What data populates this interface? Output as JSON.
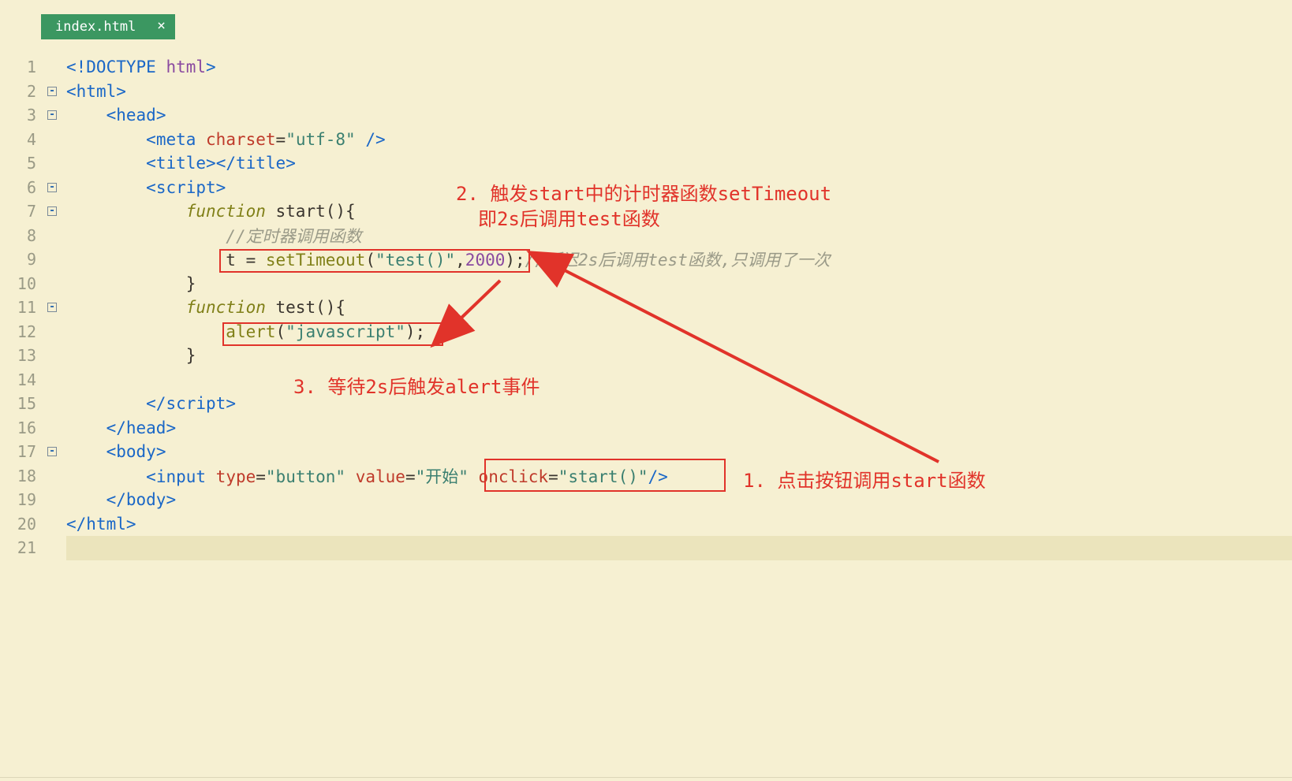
{
  "tab": {
    "filename": "index.html",
    "close_glyph": "×"
  },
  "fold_minus": "-",
  "code": {
    "l1_doctype": "<!DOCTYPE ",
    "l1_html": "html",
    "l1_close": ">",
    "l2_open": "<",
    "l2_tag": "html",
    "l2_close": ">",
    "l3_open": "<",
    "l3_tag": "head",
    "l3_close": ">",
    "l4_open": "<",
    "l4_tag": "meta ",
    "l4_attr": "charset",
    "l4_eq": "=",
    "l4_val": "\"utf-8\"",
    "l4_close": " />",
    "l5_open": "<",
    "l5_tag": "title",
    "l5_mid": ">",
    "l5_open2": "</",
    "l5_close": ">",
    "l6_open": "<",
    "l6_tag": "script",
    "l6_close": ">",
    "l7_kw": "function",
    "l7_name": " start",
    "l7_par": "(){",
    "l8_comment": "//定时器调用函数",
    "l9_pre": "t ",
    "l9_eq": "= ",
    "l9_fn": "setTimeout",
    "l9_par_open": "(",
    "l9_str": "\"test()\"",
    "l9_comma": ",",
    "l9_num": "2000",
    "l9_par_close": ");",
    "l9_comment": "//延迟2s后调用test函数,只调用了一次",
    "l10_brace": "}",
    "l11_kw": "function",
    "l11_name": " test",
    "l11_par": "(){",
    "l12_fn": "alert",
    "l12_par_open": "(",
    "l12_str": "\"javascript\"",
    "l12_par_close": ");",
    "l13_brace": "}",
    "l15_open": "</",
    "l15_tag": "script",
    "l15_close": ">",
    "l16_open": "</",
    "l16_tag": "head",
    "l16_close": ">",
    "l17_open": "<",
    "l17_tag": "body",
    "l17_close": ">",
    "l18_open": "<",
    "l18_tag": "input ",
    "l18_attr1": "type",
    "l18_eq": "=",
    "l18_val1": "\"button\"",
    "l18_sp1": " ",
    "l18_attr2": "value",
    "l18_val2": "\"开始\"",
    "l18_sp2": " ",
    "l18_attr3": "onclick",
    "l18_val3": "\"start()\"",
    "l18_close": "/>",
    "l19_open": "</",
    "l19_tag": "body",
    "l19_close": ">",
    "l20_open": "</",
    "l20_tag": "html",
    "l20_close": ">"
  },
  "annotations": {
    "a1": "1. 点击按钮调用start函数",
    "a2_line1": "2. 触发start中的计时器函数setTimeout",
    "a2_line2": "即2s后调用test函数",
    "a3": "3. 等待2s后触发alert事件"
  },
  "line_numbers": [
    "1",
    "2",
    "3",
    "4",
    "5",
    "6",
    "7",
    "8",
    "9",
    "10",
    "11",
    "12",
    "13",
    "14",
    "15",
    "16",
    "17",
    "18",
    "19",
    "20",
    "21"
  ]
}
